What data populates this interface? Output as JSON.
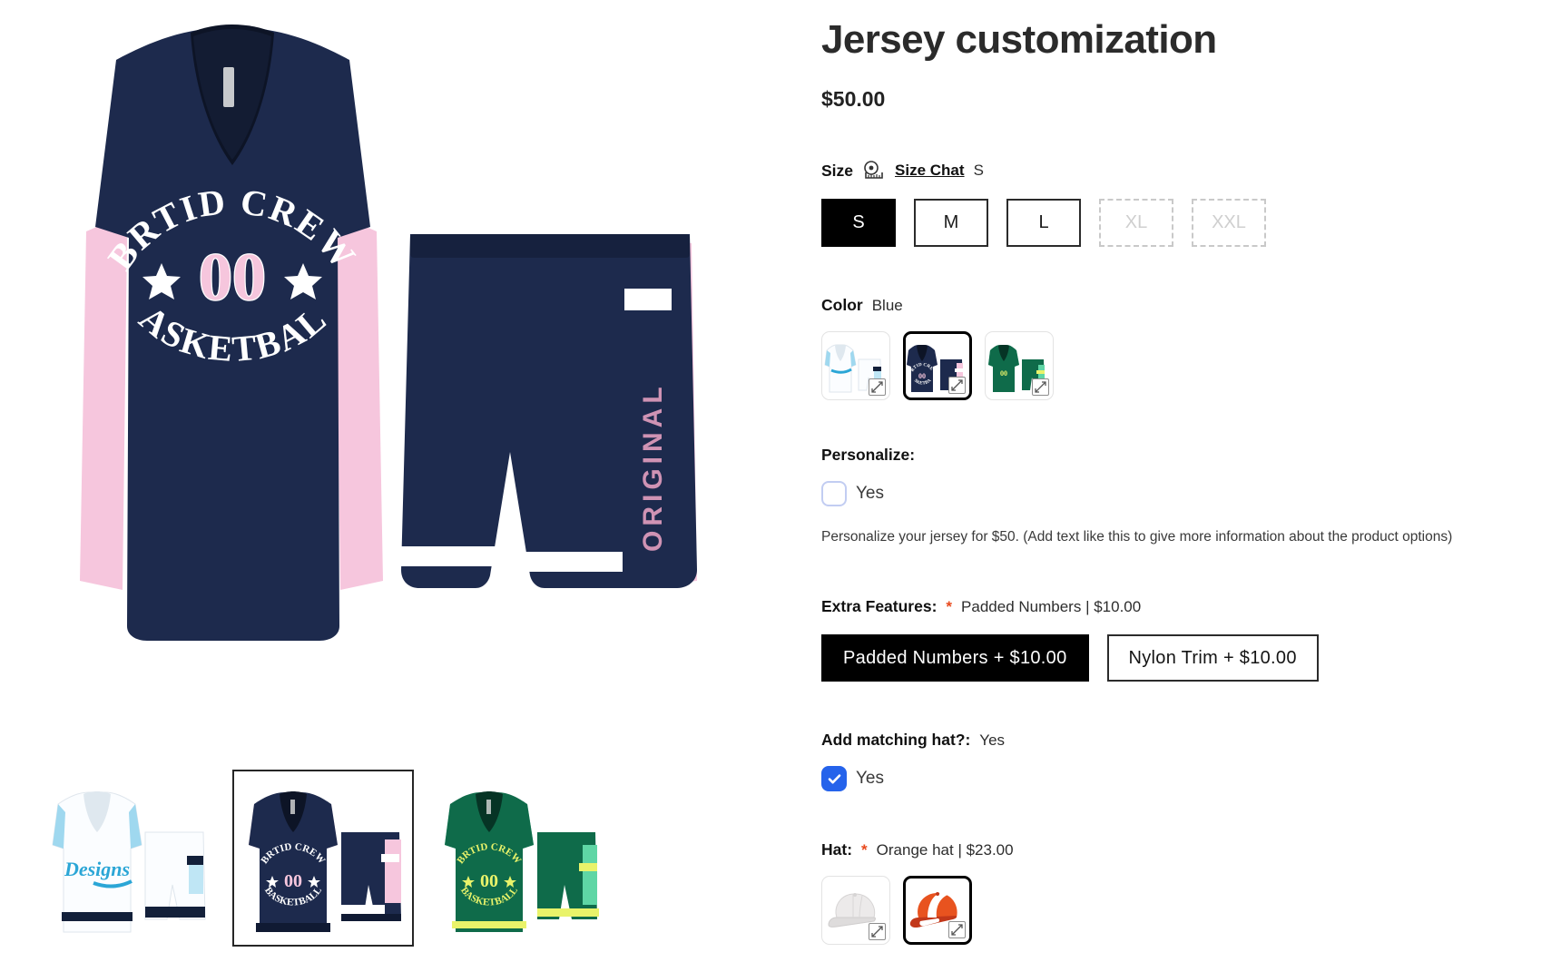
{
  "product": {
    "title": "Jersey customization",
    "price": "$50.00"
  },
  "size": {
    "label": "Size",
    "chart_link": "Size Chat",
    "selected_value": "S",
    "icon": "tape-measure-icon",
    "options": [
      {
        "label": "S",
        "selected": true,
        "disabled": false
      },
      {
        "label": "M",
        "selected": false,
        "disabled": false
      },
      {
        "label": "L",
        "selected": false,
        "disabled": false
      },
      {
        "label": "XL",
        "selected": false,
        "disabled": true
      },
      {
        "label": "XXL",
        "selected": false,
        "disabled": true
      }
    ]
  },
  "color": {
    "label": "Color",
    "selected_value": "Blue",
    "options": [
      {
        "name": "White",
        "selected": false
      },
      {
        "name": "Blue",
        "selected": true
      },
      {
        "name": "Green",
        "selected": false
      }
    ]
  },
  "personalize": {
    "heading": "Personalize:",
    "checkbox_label": "Yes",
    "checked": false,
    "help_text": "Personalize your jersey for $50. (Add text like this to give more information about the product options)"
  },
  "extra_features": {
    "label": "Extra Features:",
    "required_marker": "*",
    "selected_value": "Padded Numbers | $10.00",
    "options": [
      {
        "label": "Padded Numbers + $10.00",
        "selected": true
      },
      {
        "label": "Nylon Trim + $10.00",
        "selected": false
      }
    ]
  },
  "matching_hat": {
    "label": "Add matching hat?:",
    "selected_value": "Yes",
    "checkbox_label": "Yes",
    "checked": true
  },
  "hat": {
    "label": "Hat:",
    "required_marker": "*",
    "selected_value": "Orange hat | $23.00",
    "options": [
      {
        "name": "White hat",
        "selected": false,
        "expand_icon": "expand-arrows-icon"
      },
      {
        "name": "Orange hat",
        "selected": true,
        "expand_icon": "expand-arrows-icon"
      }
    ]
  },
  "jersey_art": {
    "top_text": "BRTID CREW",
    "number": "00",
    "bottom_text": "BASKETBALL",
    "shorts_text": "ORIGINAL"
  },
  "gallery": {
    "thumbnails": [
      {
        "name": "White jersey thumbnail",
        "script_text": "Designs",
        "selected": false
      },
      {
        "name": "Blue jersey thumbnail",
        "script_text": "",
        "selected": true
      },
      {
        "name": "Green jersey thumbnail",
        "script_text": "",
        "selected": false
      }
    ]
  },
  "colors": {
    "navy": "#1d2a4d",
    "pink": "#f6c6dd",
    "white": "#ffffff",
    "green": "#0f6b4a",
    "accent_blue": "#2563eb",
    "required_red": "#e8491d",
    "black": "#000000"
  }
}
